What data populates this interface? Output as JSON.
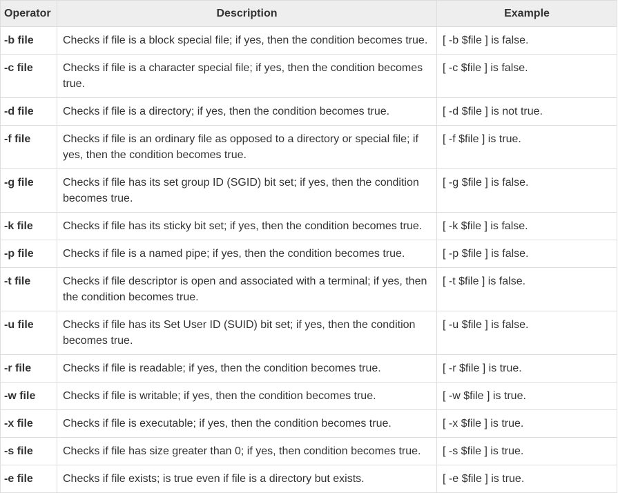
{
  "table": {
    "headers": [
      "Operator",
      "Description",
      "Example"
    ],
    "rows": [
      {
        "operator": "-b file",
        "description": "Checks if file is a block special file; if yes, then the condition becomes true.",
        "example": "[ -b $file ] is false.",
        "wrap": false
      },
      {
        "operator": "-c file",
        "description": "Checks if file is a character special file; if yes, then the condition becomes true.",
        "example": "[ -c $file ] is false.",
        "wrap": true
      },
      {
        "operator": "-d file",
        "description": "Checks if file is a directory; if yes, then the condition becomes true.",
        "example": "[ -d $file ] is not true.",
        "wrap": false
      },
      {
        "operator": "-f file",
        "description": "Checks if file is an ordinary file as opposed to a directory or special file; if yes, then the condition becomes true.",
        "example": "[ -f $file ] is true.",
        "wrap": true
      },
      {
        "operator": "-g file",
        "description": "Checks if file has its set group ID (SGID) bit set; if yes, then the condition becomes true.",
        "example": "[ -g $file ] is false.",
        "wrap": true
      },
      {
        "operator": "-k file",
        "description": "Checks if file has its sticky bit set; if yes, then the condition becomes true.",
        "example": "[ -k $file ] is false.",
        "wrap": false
      },
      {
        "operator": "-p file",
        "description": "Checks if file is a named pipe; if yes, then the condition becomes true.",
        "example": "[ -p $file ] is false.",
        "wrap": false
      },
      {
        "operator": "-t file",
        "description": "Checks if file descriptor is open and associated with a terminal; if yes, then the condition becomes true.",
        "example": "[ -t $file ] is false.",
        "wrap": true
      },
      {
        "operator": "-u file",
        "description": "Checks if file has its Set User ID (SUID) bit set; if yes, then the condition becomes true.",
        "example": "[ -u $file ] is false.",
        "wrap": true
      },
      {
        "operator": "-r file",
        "description": "Checks if file is readable; if yes, then the condition becomes true.",
        "example": "[ -r $file ] is true.",
        "wrap": false
      },
      {
        "operator": "-w file",
        "description": "Checks if file is writable; if yes, then the condition becomes true.",
        "example": "[ -w $file ] is true.",
        "wrap": false
      },
      {
        "operator": "-x file",
        "description": "Checks if file is executable; if yes, then the condition becomes true.",
        "example": "[ -x $file ] is true.",
        "wrap": false
      },
      {
        "operator": "-s file",
        "description": "Checks if file has size greater than 0; if yes, then condition becomes true.",
        "example": "[ -s $file ] is true.",
        "wrap": false
      },
      {
        "operator": "-e file",
        "description": "Checks if file exists; is true even if file is a directory but exists.",
        "example": "[ -e $file ] is true.",
        "wrap": false
      }
    ]
  }
}
